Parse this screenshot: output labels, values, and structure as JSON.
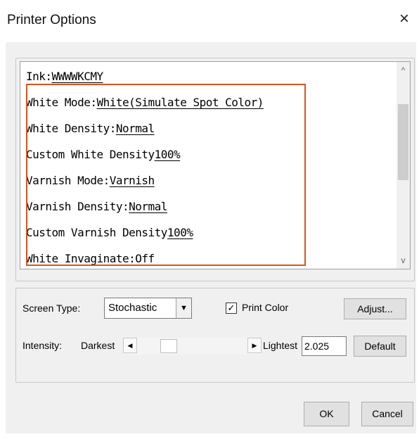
{
  "window": {
    "title": "Printer Options",
    "close_glyph": "×"
  },
  "options_list": [
    {
      "label": "Ink:",
      "value": "WWWWKCMY"
    },
    {
      "label": "White Mode:",
      "value": "White(Simulate Spot Color)"
    },
    {
      "label": "White Density:",
      "value": "Normal"
    },
    {
      "label": "Custom White Density",
      "value": "100%"
    },
    {
      "label": "Varnish Mode:",
      "value": "Varnish"
    },
    {
      "label": "Varnish Density:",
      "value": "Normal"
    },
    {
      "label": "Custom Varnish Density",
      "value": "100%"
    },
    {
      "label": "White Invaginate:",
      "value": "Off"
    }
  ],
  "scrollbar": {
    "up_glyph": "^",
    "down_glyph": "v"
  },
  "screen_type": {
    "label": "Screen Type:",
    "value": "Stochastic",
    "drop_glyph": "▼"
  },
  "print_color": {
    "label": "Print Color",
    "checked_glyph": "✓"
  },
  "buttons": {
    "adjust": "Adjust...",
    "default": "Default",
    "ok": "OK",
    "cancel": "Cancel"
  },
  "intensity": {
    "label": "Intensity:",
    "min_label": "Darkest",
    "max_label": "Lightest",
    "value": "2.025",
    "left_glyph": "◀",
    "right_glyph": "▶"
  },
  "colors": {
    "highlight_border": "#d9541e",
    "dialog_bg": "#f0f0f0"
  }
}
